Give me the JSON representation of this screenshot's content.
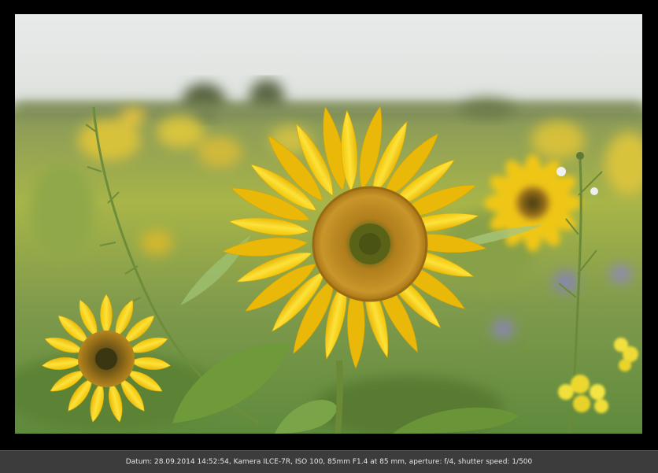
{
  "photo": {
    "subject": "sunflower-field",
    "colors": {
      "sky": "#e6e9e8",
      "field": "#8fa84a",
      "petal": "#f7d40f",
      "petal_shade": "#e9b907",
      "disc": "#b8861d",
      "disc_center": "#6b6a1d",
      "leaf": "#6f9a3a"
    }
  },
  "caption": {
    "text": "Datum:  28.09.2014 14:52:54, Kamera ILCE-7R, ISO 100, 85mm F1.4 at 85 mm, aperture:  f/4, shutter speed: 1/500"
  }
}
